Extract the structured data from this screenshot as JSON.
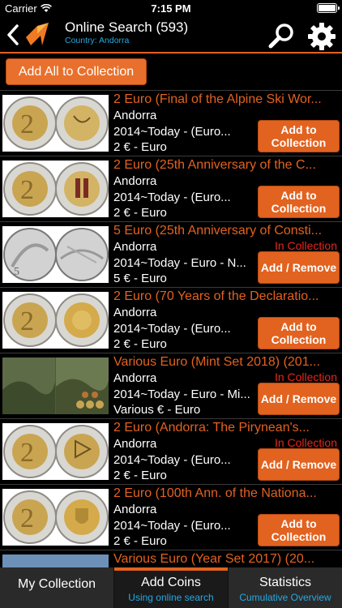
{
  "status_bar": {
    "carrier": "Carrier",
    "time": "7:15 PM"
  },
  "header": {
    "title": "Online Search (593)",
    "subtitle": "Country: Andorra"
  },
  "add_all_label": "Add All to Collection",
  "items": [
    {
      "title": "2 Euro (Final of the Alpine Ski Wor...",
      "country": "Andorra",
      "period": "2014~Today - (Euro...",
      "denomination": "2 € - Euro",
      "status": "",
      "action": "Add to Collection"
    },
    {
      "title": "2 Euro (25th Anniversary of the C...",
      "country": "Andorra",
      "period": "2014~Today - (Euro...",
      "denomination": "2 € - Euro",
      "status": "",
      "action": "Add to Collection"
    },
    {
      "title": "5 Euro (25th Anniversary of Consti...",
      "country": "Andorra",
      "period": "2014~Today - Euro - N...",
      "denomination": "5 € - Euro",
      "status": "In Collection",
      "action": "Add / Remove"
    },
    {
      "title": "2 Euro (70 Years of the Declaratio...",
      "country": "Andorra",
      "period": "2014~Today - (Euro...",
      "denomination": "2 € - Euro",
      "status": "",
      "action": "Add to Collection"
    },
    {
      "title": "Various Euro (Mint Set 2018) (201...",
      "country": "Andorra",
      "period": "2014~Today - Euro - Mi...",
      "denomination": "Various € - Euro",
      "status": "In Collection",
      "action": "Add / Remove"
    },
    {
      "title": "2 Euro (Andorra: The Pirynean's...",
      "country": "Andorra",
      "period": "2014~Today - (Euro...",
      "denomination": "2 € - Euro",
      "status": "In Collection",
      "action": "Add / Remove"
    },
    {
      "title": "2 Euro (100th Ann. of the Nationa...",
      "country": "Andorra",
      "period": "2014~Today - (Euro...",
      "denomination": "2 € - Euro",
      "status": "",
      "action": "Add to Collection"
    },
    {
      "title": "Various Euro (Year Set 2017) (20...",
      "country": "",
      "period": "",
      "denomination": "",
      "status": "",
      "action": ""
    }
  ],
  "tabs": [
    {
      "label": "My Collection",
      "sub": ""
    },
    {
      "label": "Add Coins",
      "sub": "Using online search"
    },
    {
      "label": "Statistics",
      "sub": "Cumulative Overview"
    }
  ],
  "colors": {
    "accent": "#e2621f",
    "link": "#27a9e1",
    "in_collection": "#e8261a"
  }
}
